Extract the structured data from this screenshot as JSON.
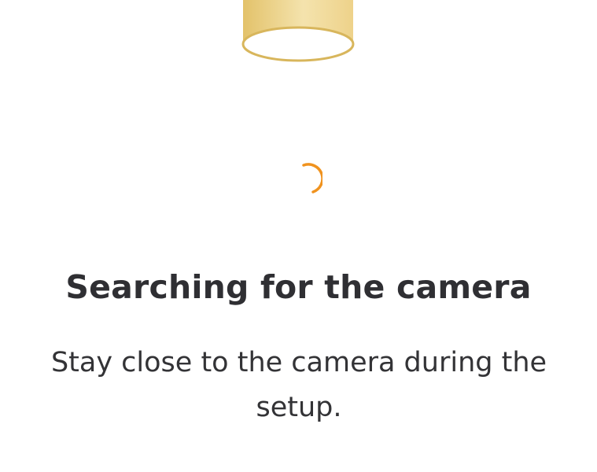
{
  "screen": {
    "title": "Searching for the camera",
    "subtitle": "Stay close to the camera during the setup."
  },
  "icons": {
    "illustration": "camera-cylinder-illustration",
    "spinner": "loading-spinner-icon"
  },
  "colors": {
    "spinner": "#f0931f",
    "camera_body_light": "#f3e0a6",
    "camera_body_dark": "#e3c26a",
    "camera_rim": "#d8b65c",
    "title_text": "#2f2f33",
    "body_text": "#333336"
  }
}
